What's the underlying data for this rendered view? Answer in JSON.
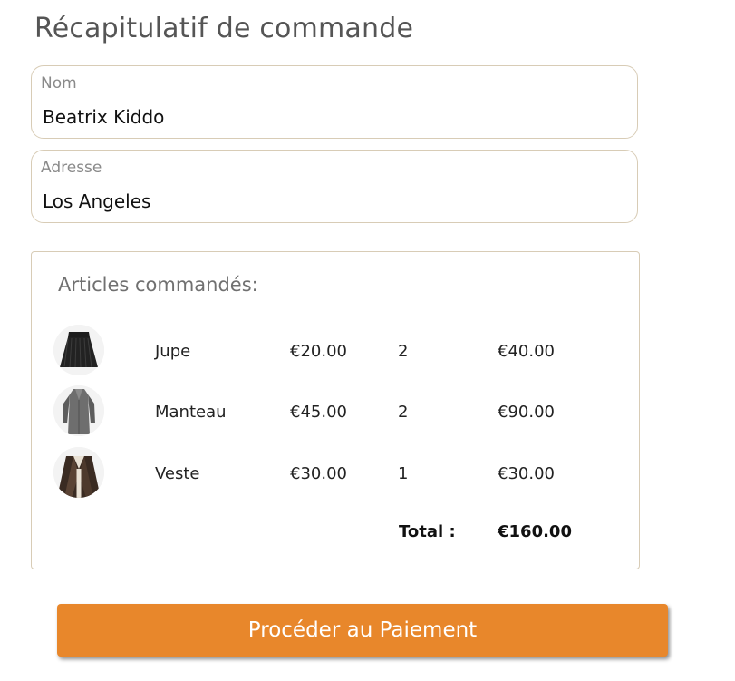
{
  "page": {
    "title": "Récapitulatif de commande"
  },
  "form": {
    "nom": {
      "label": "Nom",
      "value": "Beatrix Kiddo"
    },
    "adresse": {
      "label": "Adresse",
      "value": "Los Angeles"
    }
  },
  "order": {
    "heading": "Articles commandés:",
    "items": [
      {
        "name": "Jupe",
        "price": "€20.00",
        "qty": "2",
        "subtotal": "€40.00",
        "image": "black-pleated-skirt"
      },
      {
        "name": "Manteau",
        "price": "€45.00",
        "qty": "2",
        "subtotal": "€90.00",
        "image": "grey-long-coat"
      },
      {
        "name": "Veste",
        "price": "€30.00",
        "qty": "1",
        "subtotal": "€30.00",
        "image": "brown-leather-jacket"
      }
    ],
    "total_label": "Total :",
    "total_value": "€160.00"
  },
  "actions": {
    "pay_label": "Procéder au Paiement"
  },
  "colors": {
    "accent": "#e8872b",
    "border": "#d8ccb6"
  }
}
